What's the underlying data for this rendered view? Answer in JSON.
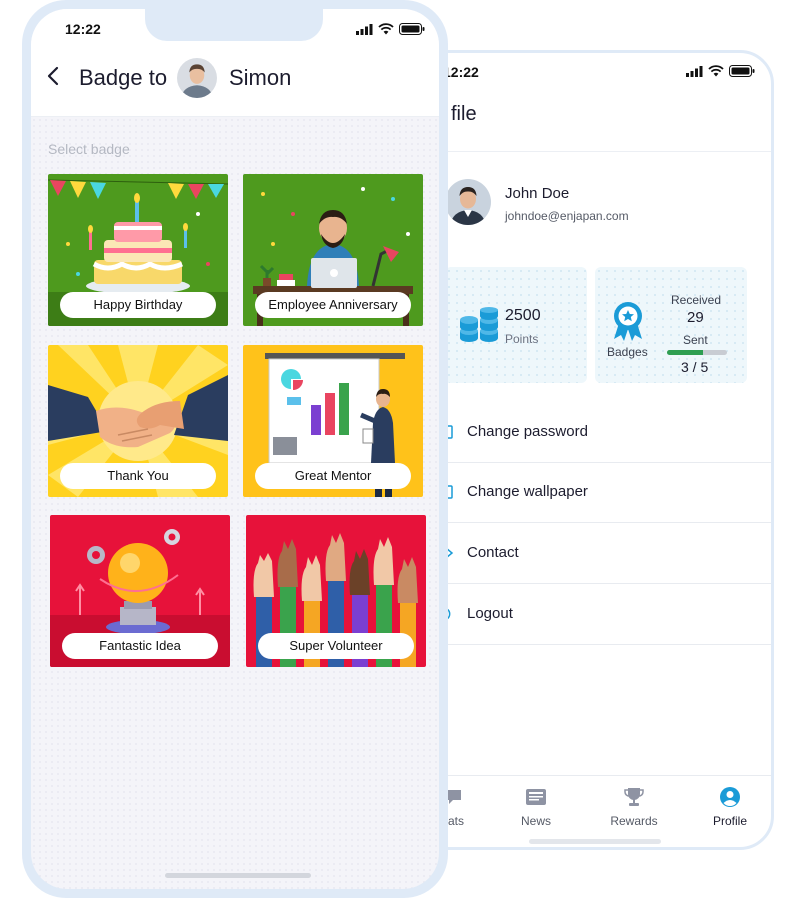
{
  "front": {
    "status_time": "12:22",
    "title": "Badge to",
    "recipient": "Simon",
    "select_label": "Select badge",
    "badges": [
      {
        "label": "Happy Birthday"
      },
      {
        "label": "Employee Anniversary"
      },
      {
        "label": "Thank You"
      },
      {
        "label": "Great Mentor"
      },
      {
        "label": "Fantastic Idea"
      },
      {
        "label": "Super Volunteer"
      }
    ]
  },
  "profile": {
    "status_time": "12:22",
    "title": "file",
    "user": {
      "name": "John Doe",
      "email": "johndoe@enjapan.com"
    },
    "points": {
      "value": "2500",
      "label": "Points"
    },
    "badges": {
      "label": "Badges",
      "received_label": "Received",
      "received": "29",
      "sent_label": "Sent",
      "sent": "3 / 5",
      "sent_fraction": 0.6
    },
    "menu": [
      {
        "label": "Change password",
        "icon": "lock-icon"
      },
      {
        "label": "Change wallpaper",
        "icon": "image-icon"
      },
      {
        "label": "Contact",
        "icon": "mail-icon"
      },
      {
        "label": "Logout",
        "icon": "logout-icon"
      }
    ],
    "tabs": [
      {
        "label": "ats",
        "icon": "chat-icon"
      },
      {
        "label": "News",
        "icon": "news-icon"
      },
      {
        "label": "Rewards",
        "icon": "trophy-icon"
      },
      {
        "label": "Profile",
        "icon": "profile-icon",
        "active": true
      }
    ],
    "accent": "#1a9bd7"
  }
}
